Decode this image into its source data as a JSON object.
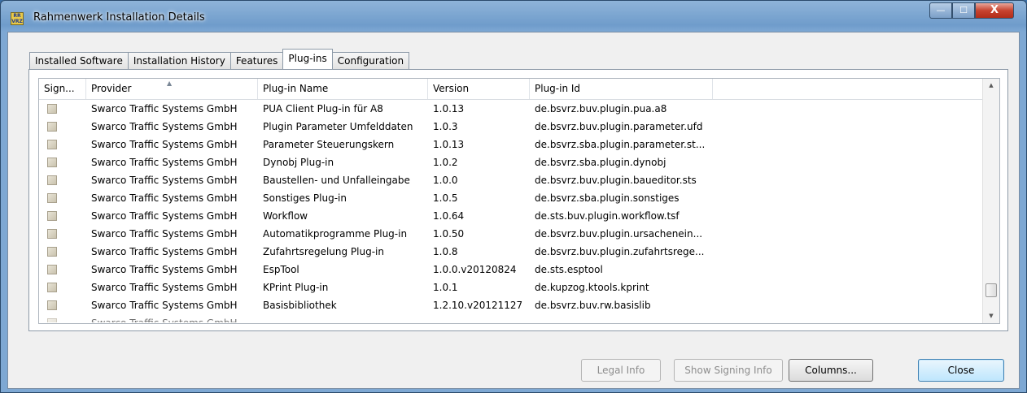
{
  "window": {
    "title": "Rahmenwerk Installation Details",
    "app_icon_text": "RR VRZ",
    "controls": {
      "minimize": "—",
      "maximize": "☐",
      "close": "X"
    }
  },
  "tabs": [
    {
      "label": "Installed Software",
      "active": false
    },
    {
      "label": "Installation History",
      "active": false
    },
    {
      "label": "Features",
      "active": false
    },
    {
      "label": "Plug-ins",
      "active": true
    },
    {
      "label": "Configuration",
      "active": false
    }
  ],
  "table": {
    "columns": {
      "signed": "Sign...",
      "provider": "Provider",
      "name": "Plug-in Name",
      "version": "Version",
      "id": "Plug-in Id"
    },
    "sorted_by": "provider",
    "rows": [
      {
        "provider": "Swarco Traffic Systems GmbH",
        "name": "PUA Client Plug-in für A8",
        "version": "1.0.13",
        "id": "de.bsvrz.buv.plugin.pua.a8"
      },
      {
        "provider": "Swarco Traffic Systems GmbH",
        "name": "Plugin Parameter Umfelddaten",
        "version": "1.0.3",
        "id": "de.bsvrz.buv.plugin.parameter.ufd"
      },
      {
        "provider": "Swarco Traffic Systems GmbH",
        "name": "Parameter Steuerungskern",
        "version": "1.0.13",
        "id": "de.bsvrz.sba.plugin.parameter.st..."
      },
      {
        "provider": "Swarco Traffic Systems GmbH",
        "name": "Dynobj Plug-in",
        "version": "1.0.2",
        "id": "de.bsvrz.sba.plugin.dynobj"
      },
      {
        "provider": "Swarco Traffic Systems GmbH",
        "name": "Baustellen- und Unfalleingabe",
        "version": "1.0.0",
        "id": "de.bsvrz.buv.plugin.baueditor.sts"
      },
      {
        "provider": "Swarco Traffic Systems GmbH",
        "name": "Sonstiges Plug-in",
        "version": "1.0.5",
        "id": "de.bsvrz.sba.plugin.sonstiges"
      },
      {
        "provider": "Swarco Traffic Systems GmbH",
        "name": "Workflow",
        "version": "1.0.64",
        "id": "de.sts.buv.plugin.workflow.tsf"
      },
      {
        "provider": "Swarco Traffic Systems GmbH",
        "name": "Automatikprogramme Plug-in",
        "version": "1.0.50",
        "id": "de.bsvrz.buv.plugin.ursachenein..."
      },
      {
        "provider": "Swarco Traffic Systems GmbH",
        "name": "Zufahrtsregelung Plug-in",
        "version": "1.0.8",
        "id": "de.bsvrz.buv.plugin.zufahrtsrege..."
      },
      {
        "provider": "Swarco Traffic Systems GmbH",
        "name": "EspTool",
        "version": "1.0.0.v20120824",
        "id": "de.sts.esptool"
      },
      {
        "provider": "Swarco Traffic Systems GmbH",
        "name": "KPrint Plug-in",
        "version": "1.0.1",
        "id": "de.kupzog.ktools.kprint"
      },
      {
        "provider": "Swarco Traffic Systems GmbH",
        "name": "Basisbibliothek",
        "version": "1.2.10.v20121127",
        "id": "de.bsvrz.buv.rw.basislib"
      }
    ],
    "partial_row": {
      "provider": "Swarco Traffic Systems GmbH"
    }
  },
  "buttons": {
    "legal_info": "Legal Info",
    "show_signing_info": "Show Signing Info",
    "columns": "Columns...",
    "close": "Close"
  }
}
